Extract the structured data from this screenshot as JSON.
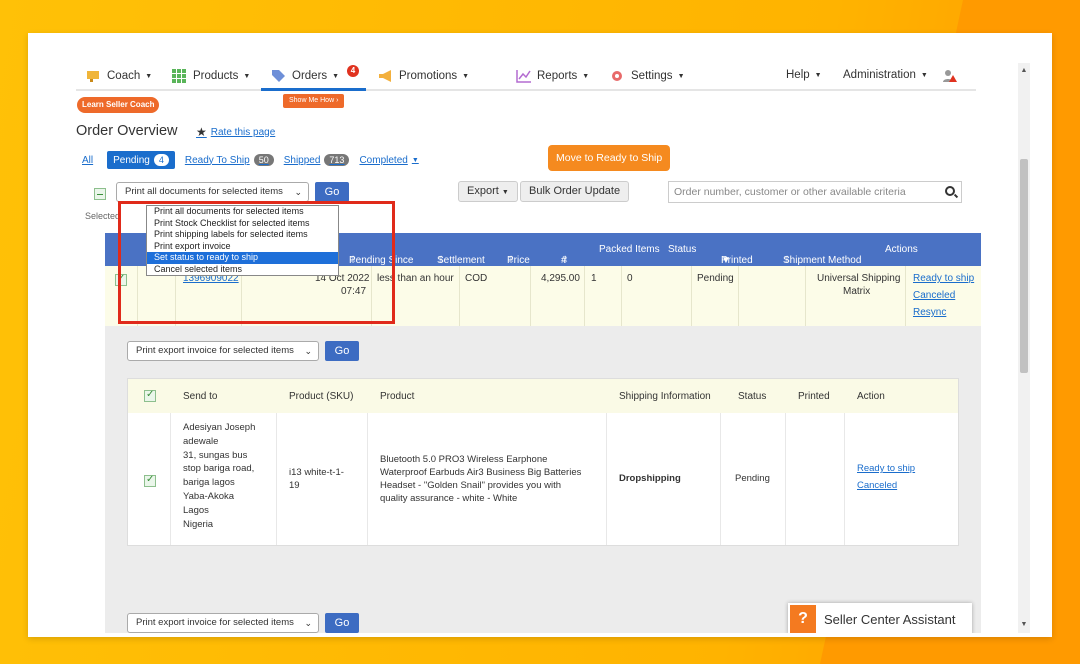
{
  "nav": {
    "items": [
      {
        "label": "Coach"
      },
      {
        "label": "Products"
      },
      {
        "label": "Orders"
      },
      {
        "label": "Promotions"
      },
      {
        "label": "Reports"
      },
      {
        "label": "Settings"
      },
      {
        "label": "Help"
      },
      {
        "label": "Administration"
      }
    ],
    "orders_badge": "4",
    "show_me_how": "Show Me How",
    "learn_seller_coach": "Learn Seller Coach"
  },
  "page": {
    "title": "Order Overview",
    "rate_link": "Rate this page"
  },
  "tabs": [
    {
      "label": "All"
    },
    {
      "label": "Pending",
      "count": "4"
    },
    {
      "label": "Ready To Ship",
      "count": "50"
    },
    {
      "label": "Shipped",
      "count": "713"
    },
    {
      "label": "Completed"
    }
  ],
  "move_button": "Move to Ready to Ship",
  "controls": {
    "bulk_select_value": "Print all documents for selected items",
    "go": "Go",
    "export": "Export",
    "bulk_update": "Bulk Order Update",
    "search_placeholder": "Order number, customer or other available criteria",
    "selected_label": "Selected"
  },
  "dropdown_options": [
    "Print all documents for selected items",
    "Print Stock Checklist for selected items",
    "Print shipping labels for selected items",
    "Print export invoice",
    "Set status to ready to ship",
    "Cancel selected items"
  ],
  "orders_table": {
    "headers": [
      "ate",
      "Pending Since",
      "Settlement",
      "Price",
      "#",
      "Packed Items",
      "Status",
      "Printed",
      "Shipment Method",
      "Actions"
    ],
    "row": {
      "order_number": "1396909022",
      "date": "14 Oct 2022",
      "time": "07:47",
      "pending_since": "less than an hour",
      "settlement": "COD",
      "price": "4,295.00",
      "qty": "1",
      "packed": "0",
      "status": "Pending",
      "shipment_method_1": "Universal Shipping",
      "shipment_method_2": "Matrix",
      "action_ready": "Ready to ship",
      "action_canceled": "Canceled",
      "action_resync": "Resync"
    }
  },
  "detail": {
    "select_value": "Print export invoice for selected items",
    "go": "Go",
    "headers": [
      "Send to",
      "Product (SKU)",
      "Product",
      "Shipping Information",
      "Status",
      "Printed",
      "Action"
    ],
    "address_lines": [
      "Adesiyan Joseph",
      "adewale",
      "31, sungas bus",
      "stop bariga road,",
      "bariga lagos",
      "Yaba-Akoka",
      "Lagos",
      "Nigeria"
    ],
    "sku_lines": [
      "i13 white-t-1-",
      "19"
    ],
    "product_lines": [
      "Bluetooth 5.0 PRO3 Wireless Earphone",
      "Waterproof Earbuds Air3 Business Big Batteries",
      "Headset - \"Golden Snail\" provides you with",
      "quality assurance - white - White"
    ],
    "shipping": "Dropshipping",
    "status": "Pending",
    "action_ready": "Ready to ship",
    "action_canceled": "Canceled"
  },
  "assistant": {
    "label": "Seller Center Assistant",
    "icon": "?"
  },
  "colors": {
    "accent": "#1a6dcc",
    "header_blue": "#4a72c4",
    "orange": "#f58a1f",
    "highlight_red": "#e02a1a"
  }
}
